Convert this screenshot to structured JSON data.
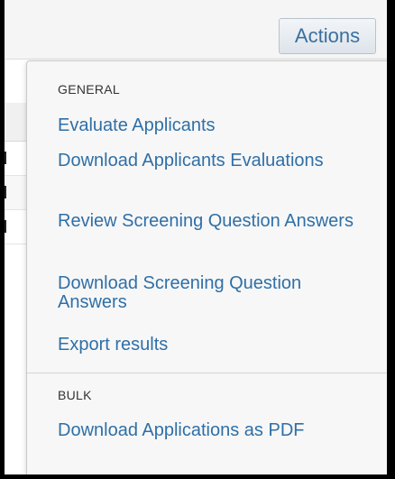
{
  "header": {
    "actions_label": "Actions"
  },
  "menu": {
    "sections": [
      {
        "title": "GENERAL",
        "items": [
          {
            "label": "Evaluate Applicants"
          },
          {
            "label": "Download Applicants Evaluations"
          },
          {
            "label": "Review Screening Question Answers"
          },
          {
            "label": "Download Screening Question Answers"
          },
          {
            "label": "Export results"
          }
        ]
      },
      {
        "title": "BULK",
        "items": [
          {
            "label": "Download Applications as PDF"
          }
        ]
      }
    ]
  },
  "colors": {
    "link": "#2f6fa7",
    "menu_background": "#f7f7f7",
    "outer_frame": "#000000"
  }
}
